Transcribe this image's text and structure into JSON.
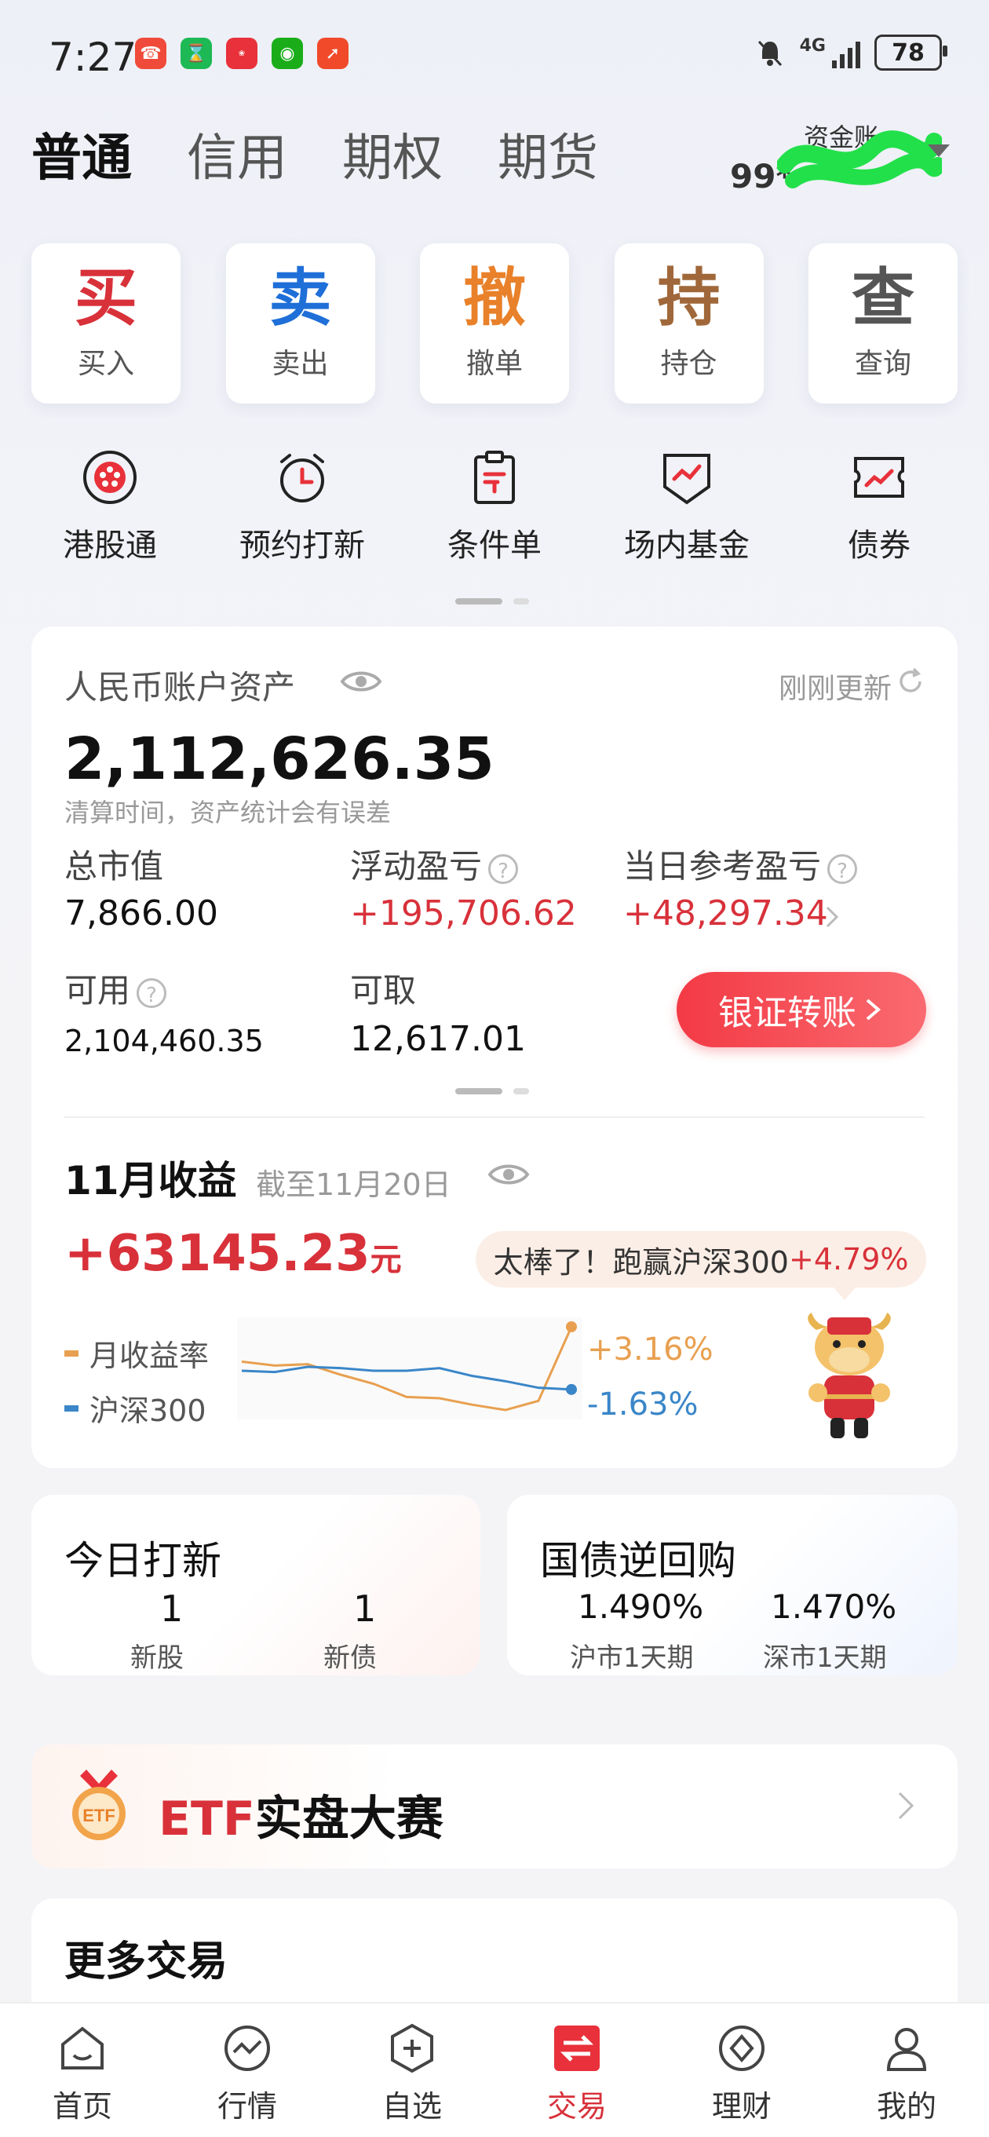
{
  "status_bar": {
    "time": "7:27",
    "network": "4G",
    "battery": "78",
    "app_icons": [
      {
        "name": "phone-app-icon",
        "color": "#f04a3a"
      },
      {
        "name": "hourglass-app-icon",
        "color": "#1db954"
      },
      {
        "name": "huawei-app-icon",
        "color": "#e8313a"
      },
      {
        "name": "wechat-app-icon",
        "color": "#1aad19"
      },
      {
        "name": "stock-app-icon",
        "color": "#f04a2a"
      }
    ]
  },
  "account_tabs": [
    "普通",
    "信用",
    "期权",
    "期货"
  ],
  "active_tab": "普通",
  "account": {
    "label": "资金账",
    "number_prefix": "99*"
  },
  "actions": [
    {
      "big": "买",
      "small": "买入",
      "color": "#d8313a"
    },
    {
      "big": "卖",
      "small": "卖出",
      "color": "#1f6fd8"
    },
    {
      "big": "撤",
      "small": "撤单",
      "color": "#e8812a"
    },
    {
      "big": "持",
      "small": "持仓",
      "color": "#a0683a"
    },
    {
      "big": "查",
      "small": "查询",
      "color": "#555555"
    }
  ],
  "quick_icons": [
    {
      "label": "港股通",
      "icon": "hk-connect-icon"
    },
    {
      "label": "预约打新",
      "icon": "alarm-clock-icon"
    },
    {
      "label": "条件单",
      "icon": "clipboard-icon"
    },
    {
      "label": "场内基金",
      "icon": "fund-shield-icon"
    },
    {
      "label": "债券",
      "icon": "bond-ticket-icon"
    }
  ],
  "asset": {
    "title": "人民币账户资产",
    "updated": "刚刚更新",
    "total": "2,112,626.35",
    "note": "清算时间，资产统计会有误差",
    "market_value_label": "总市值",
    "market_value": "7,866.00",
    "floating_pl_label": "浮动盈亏",
    "floating_pl": "+195,706.62",
    "daily_pl_label": "当日参考盈亏",
    "daily_pl": "+48,297.34",
    "available_label": "可用",
    "available": "2,104,460.35",
    "withdrawable_label": "可取",
    "withdrawable": "12,617.01",
    "transfer_button": "银证转账"
  },
  "monthly": {
    "title": "11月收益",
    "as_of": "截至11月20日",
    "gain": "+63145.23",
    "unit": "元",
    "bubble_text": "太棒了！跑赢沪深300",
    "bubble_value": "+4.79%",
    "legend_monthly": "月收益率",
    "legend_index": "沪深300",
    "monthly_rate": "+3.16%",
    "index_rate": "-1.63%",
    "colors": {
      "monthly": "#e8a050",
      "index": "#3a86c8"
    }
  },
  "chart_data": {
    "type": "line",
    "x": [
      1,
      2,
      3,
      4,
      5,
      6,
      7,
      8,
      9,
      10,
      11
    ],
    "series": [
      {
        "name": "月收益率",
        "values": [
          0.5,
          0.2,
          0.3,
          -0.5,
          -1.2,
          -2.2,
          -2.3,
          -2.8,
          -3.2,
          -2.5,
          3.16
        ]
      },
      {
        "name": "沪深300",
        "values": [
          -0.2,
          -0.3,
          0.1,
          0.0,
          -0.2,
          -0.2,
          0.0,
          -0.6,
          -1.0,
          -1.5,
          -1.63
        ]
      }
    ]
  },
  "ipo": {
    "title": "今日打新",
    "stocks_count": "1",
    "stocks_label": "新股",
    "bonds_count": "1",
    "bonds_label": "新债"
  },
  "repo": {
    "title": "国债逆回购",
    "sh_rate": "1.490%",
    "sh_label": "沪市1天期",
    "sz_rate": "1.470%",
    "sz_label": "深市1天期"
  },
  "etf": {
    "prefix": "ETF",
    "text": "实盘大赛",
    "badge": "ETF"
  },
  "more_trade": {
    "title": "更多交易"
  },
  "nav": [
    {
      "label": "首页",
      "icon": "home-icon"
    },
    {
      "label": "行情",
      "icon": "market-icon"
    },
    {
      "label": "自选",
      "icon": "watchlist-icon"
    },
    {
      "label": "交易",
      "icon": "trade-icon"
    },
    {
      "label": "理财",
      "icon": "wealth-icon"
    },
    {
      "label": "我的",
      "icon": "profile-icon"
    }
  ]
}
